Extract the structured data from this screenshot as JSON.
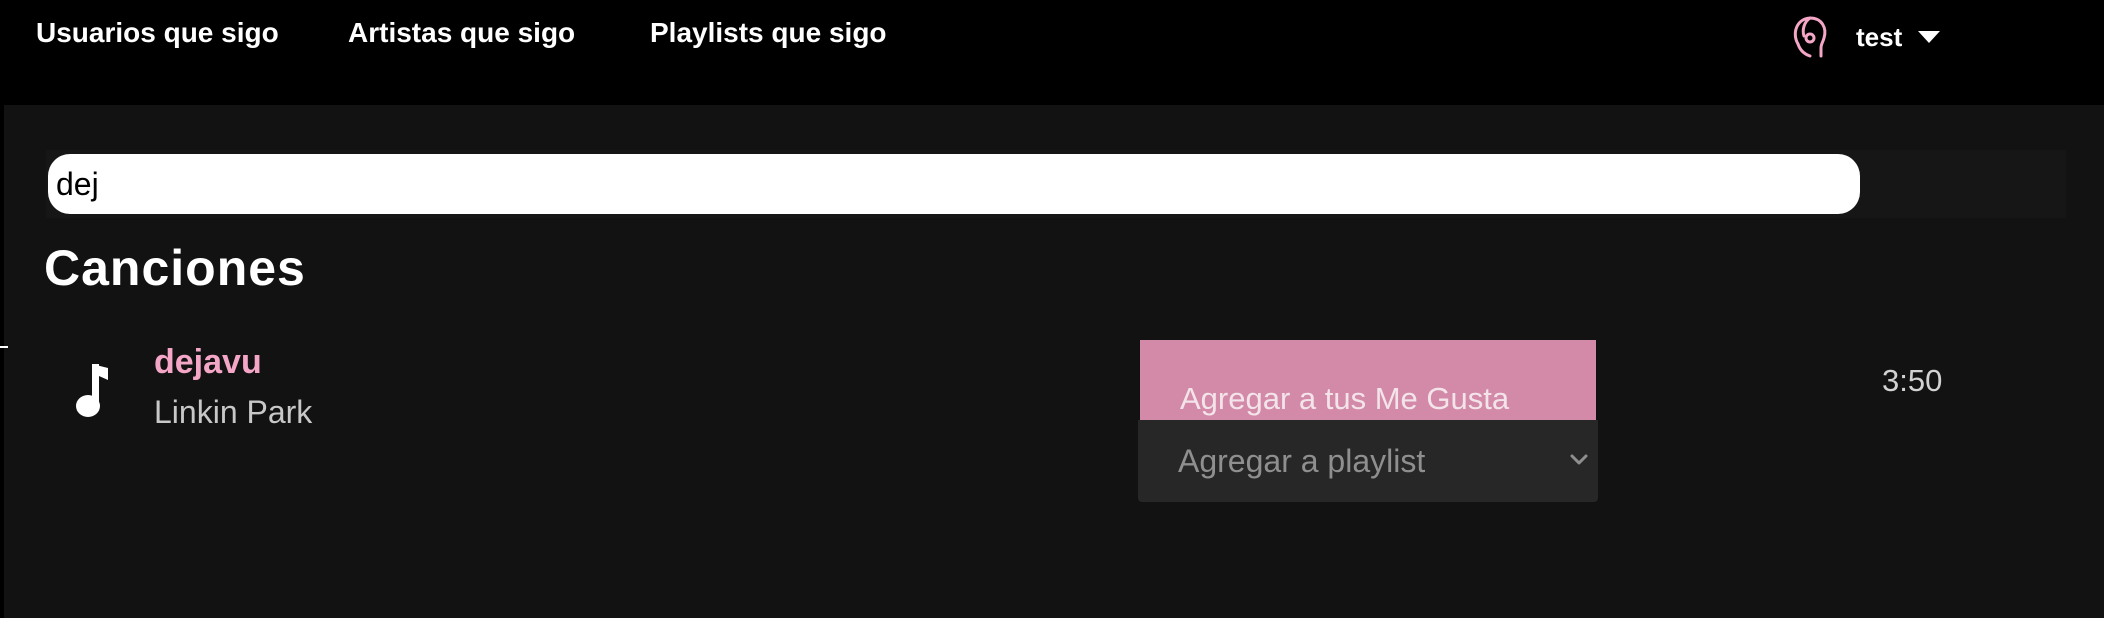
{
  "nav": {
    "links": [
      {
        "label": "Usuarios que sigo"
      },
      {
        "label": "Artistas que sigo"
      },
      {
        "label": "Playlists que sigo"
      }
    ],
    "user": {
      "name": "test",
      "icon": "user-headphones-icon"
    }
  },
  "search": {
    "value": "dej"
  },
  "results": {
    "section_title": "Canciones",
    "songs": [
      {
        "title": "dejavu",
        "artist": "Linkin Park",
        "duration": "3:50",
        "icon": "music-note-icon",
        "like_label": "Agregar a tus Me Gusta",
        "playlist_select": "Agregar a playlist"
      }
    ]
  },
  "colors": {
    "accent_pink": "#f4a6c6",
    "like_button_bg": "#d38aa8",
    "topbar_bg": "#000000",
    "content_bg": "#121212"
  }
}
